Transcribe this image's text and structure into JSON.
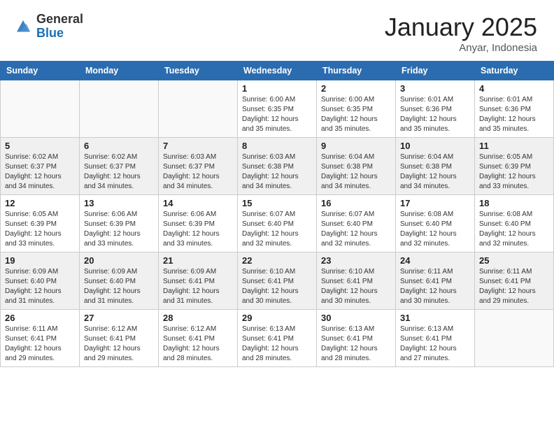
{
  "logo": {
    "general": "General",
    "blue": "Blue"
  },
  "title": "January 2025",
  "location": "Anyar, Indonesia",
  "days_header": [
    "Sunday",
    "Monday",
    "Tuesday",
    "Wednesday",
    "Thursday",
    "Friday",
    "Saturday"
  ],
  "weeks": [
    {
      "shaded": false,
      "days": [
        {
          "num": "",
          "sunrise": "",
          "sunset": "",
          "daylight": "",
          "empty": true
        },
        {
          "num": "",
          "sunrise": "",
          "sunset": "",
          "daylight": "",
          "empty": true
        },
        {
          "num": "",
          "sunrise": "",
          "sunset": "",
          "daylight": "",
          "empty": true
        },
        {
          "num": "1",
          "sunrise": "Sunrise: 6:00 AM",
          "sunset": "Sunset: 6:35 PM",
          "daylight": "Daylight: 12 hours and 35 minutes.",
          "empty": false
        },
        {
          "num": "2",
          "sunrise": "Sunrise: 6:00 AM",
          "sunset": "Sunset: 6:35 PM",
          "daylight": "Daylight: 12 hours and 35 minutes.",
          "empty": false
        },
        {
          "num": "3",
          "sunrise": "Sunrise: 6:01 AM",
          "sunset": "Sunset: 6:36 PM",
          "daylight": "Daylight: 12 hours and 35 minutes.",
          "empty": false
        },
        {
          "num": "4",
          "sunrise": "Sunrise: 6:01 AM",
          "sunset": "Sunset: 6:36 PM",
          "daylight": "Daylight: 12 hours and 35 minutes.",
          "empty": false
        }
      ]
    },
    {
      "shaded": true,
      "days": [
        {
          "num": "5",
          "sunrise": "Sunrise: 6:02 AM",
          "sunset": "Sunset: 6:37 PM",
          "daylight": "Daylight: 12 hours and 34 minutes.",
          "empty": false
        },
        {
          "num": "6",
          "sunrise": "Sunrise: 6:02 AM",
          "sunset": "Sunset: 6:37 PM",
          "daylight": "Daylight: 12 hours and 34 minutes.",
          "empty": false
        },
        {
          "num": "7",
          "sunrise": "Sunrise: 6:03 AM",
          "sunset": "Sunset: 6:37 PM",
          "daylight": "Daylight: 12 hours and 34 minutes.",
          "empty": false
        },
        {
          "num": "8",
          "sunrise": "Sunrise: 6:03 AM",
          "sunset": "Sunset: 6:38 PM",
          "daylight": "Daylight: 12 hours and 34 minutes.",
          "empty": false
        },
        {
          "num": "9",
          "sunrise": "Sunrise: 6:04 AM",
          "sunset": "Sunset: 6:38 PM",
          "daylight": "Daylight: 12 hours and 34 minutes.",
          "empty": false
        },
        {
          "num": "10",
          "sunrise": "Sunrise: 6:04 AM",
          "sunset": "Sunset: 6:38 PM",
          "daylight": "Daylight: 12 hours and 34 minutes.",
          "empty": false
        },
        {
          "num": "11",
          "sunrise": "Sunrise: 6:05 AM",
          "sunset": "Sunset: 6:39 PM",
          "daylight": "Daylight: 12 hours and 33 minutes.",
          "empty": false
        }
      ]
    },
    {
      "shaded": false,
      "days": [
        {
          "num": "12",
          "sunrise": "Sunrise: 6:05 AM",
          "sunset": "Sunset: 6:39 PM",
          "daylight": "Daylight: 12 hours and 33 minutes.",
          "empty": false
        },
        {
          "num": "13",
          "sunrise": "Sunrise: 6:06 AM",
          "sunset": "Sunset: 6:39 PM",
          "daylight": "Daylight: 12 hours and 33 minutes.",
          "empty": false
        },
        {
          "num": "14",
          "sunrise": "Sunrise: 6:06 AM",
          "sunset": "Sunset: 6:39 PM",
          "daylight": "Daylight: 12 hours and 33 minutes.",
          "empty": false
        },
        {
          "num": "15",
          "sunrise": "Sunrise: 6:07 AM",
          "sunset": "Sunset: 6:40 PM",
          "daylight": "Daylight: 12 hours and 32 minutes.",
          "empty": false
        },
        {
          "num": "16",
          "sunrise": "Sunrise: 6:07 AM",
          "sunset": "Sunset: 6:40 PM",
          "daylight": "Daylight: 12 hours and 32 minutes.",
          "empty": false
        },
        {
          "num": "17",
          "sunrise": "Sunrise: 6:08 AM",
          "sunset": "Sunset: 6:40 PM",
          "daylight": "Daylight: 12 hours and 32 minutes.",
          "empty": false
        },
        {
          "num": "18",
          "sunrise": "Sunrise: 6:08 AM",
          "sunset": "Sunset: 6:40 PM",
          "daylight": "Daylight: 12 hours and 32 minutes.",
          "empty": false
        }
      ]
    },
    {
      "shaded": true,
      "days": [
        {
          "num": "19",
          "sunrise": "Sunrise: 6:09 AM",
          "sunset": "Sunset: 6:40 PM",
          "daylight": "Daylight: 12 hours and 31 minutes.",
          "empty": false
        },
        {
          "num": "20",
          "sunrise": "Sunrise: 6:09 AM",
          "sunset": "Sunset: 6:40 PM",
          "daylight": "Daylight: 12 hours and 31 minutes.",
          "empty": false
        },
        {
          "num": "21",
          "sunrise": "Sunrise: 6:09 AM",
          "sunset": "Sunset: 6:41 PM",
          "daylight": "Daylight: 12 hours and 31 minutes.",
          "empty": false
        },
        {
          "num": "22",
          "sunrise": "Sunrise: 6:10 AM",
          "sunset": "Sunset: 6:41 PM",
          "daylight": "Daylight: 12 hours and 30 minutes.",
          "empty": false
        },
        {
          "num": "23",
          "sunrise": "Sunrise: 6:10 AM",
          "sunset": "Sunset: 6:41 PM",
          "daylight": "Daylight: 12 hours and 30 minutes.",
          "empty": false
        },
        {
          "num": "24",
          "sunrise": "Sunrise: 6:11 AM",
          "sunset": "Sunset: 6:41 PM",
          "daylight": "Daylight: 12 hours and 30 minutes.",
          "empty": false
        },
        {
          "num": "25",
          "sunrise": "Sunrise: 6:11 AM",
          "sunset": "Sunset: 6:41 PM",
          "daylight": "Daylight: 12 hours and 29 minutes.",
          "empty": false
        }
      ]
    },
    {
      "shaded": false,
      "days": [
        {
          "num": "26",
          "sunrise": "Sunrise: 6:11 AM",
          "sunset": "Sunset: 6:41 PM",
          "daylight": "Daylight: 12 hours and 29 minutes.",
          "empty": false
        },
        {
          "num": "27",
          "sunrise": "Sunrise: 6:12 AM",
          "sunset": "Sunset: 6:41 PM",
          "daylight": "Daylight: 12 hours and 29 minutes.",
          "empty": false
        },
        {
          "num": "28",
          "sunrise": "Sunrise: 6:12 AM",
          "sunset": "Sunset: 6:41 PM",
          "daylight": "Daylight: 12 hours and 28 minutes.",
          "empty": false
        },
        {
          "num": "29",
          "sunrise": "Sunrise: 6:13 AM",
          "sunset": "Sunset: 6:41 PM",
          "daylight": "Daylight: 12 hours and 28 minutes.",
          "empty": false
        },
        {
          "num": "30",
          "sunrise": "Sunrise: 6:13 AM",
          "sunset": "Sunset: 6:41 PM",
          "daylight": "Daylight: 12 hours and 28 minutes.",
          "empty": false
        },
        {
          "num": "31",
          "sunrise": "Sunrise: 6:13 AM",
          "sunset": "Sunset: 6:41 PM",
          "daylight": "Daylight: 12 hours and 27 minutes.",
          "empty": false
        },
        {
          "num": "",
          "sunrise": "",
          "sunset": "",
          "daylight": "",
          "empty": true
        }
      ]
    }
  ]
}
